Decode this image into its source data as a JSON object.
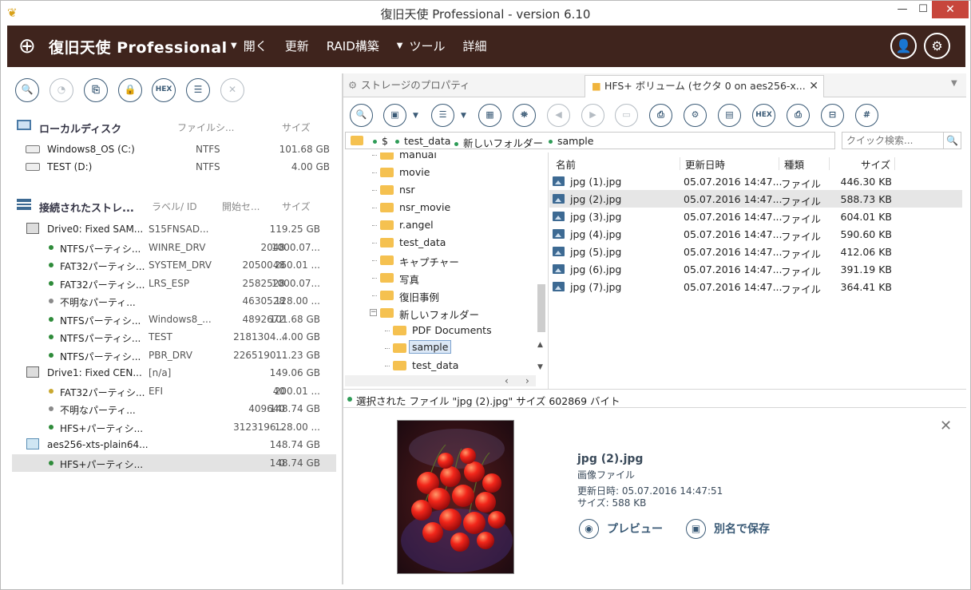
{
  "window": {
    "title": "復旧天使 Professional - version 6.10"
  },
  "header": {
    "brand": "復旧天使 Professional",
    "menu": [
      {
        "label": "開く",
        "caret": true
      },
      {
        "label": "更新",
        "caret": false
      },
      {
        "label": "RAID構築",
        "caret": false
      },
      {
        "label": "ツール",
        "caret": true
      },
      {
        "label": "詳細",
        "caret": false
      }
    ]
  },
  "left": {
    "toolbar_hex": "HEX",
    "local": {
      "title": "ローカルディスク",
      "col_fs": "ファイルシ...",
      "col_size": "サイズ",
      "rows": [
        {
          "name": "Windows8_OS (C:)",
          "fs": "NTFS",
          "size": "101.68 GB"
        },
        {
          "name": "TEST (D:)",
          "fs": "NTFS",
          "size": "4.00 GB"
        }
      ]
    },
    "connected": {
      "title": "接続されたストレ...",
      "col_label": "ラベル/ ID",
      "col_start": "開始セ...",
      "col_size": "サイズ",
      "rows": [
        {
          "type": "drive",
          "name": "Drive0: Fixed SAM...",
          "label": "S15FNSAD...",
          "start": "",
          "size": "119.25 GB"
        },
        {
          "type": "part",
          "color": "#2e8b3a",
          "name": "NTFSパーティシ...",
          "label": "WINRE_DRV",
          "start": "2048",
          "size": "1000.07..."
        },
        {
          "type": "part",
          "color": "#2e8b3a",
          "name": "FAT32パーティシ...",
          "label": "SYSTEM_DRV",
          "start": "2050048",
          "size": "260.01 ..."
        },
        {
          "type": "part",
          "color": "#2e8b3a",
          "name": "FAT32パーティシ...",
          "label": "LRS_ESP",
          "start": "2582528",
          "size": "1000.07..."
        },
        {
          "type": "part",
          "color": "#8a8a8a",
          "name": "不明なパーティ...",
          "label": "",
          "start": "4630528",
          "size": "128.00 ..."
        },
        {
          "type": "part",
          "color": "#2e8b3a",
          "name": "NTFSパーティシ...",
          "label": "Windows8_...",
          "start": "4892672",
          "size": "101.68 GB"
        },
        {
          "type": "part",
          "color": "#2e8b3a",
          "name": "NTFSパーティシ...",
          "label": "TEST",
          "start": "2181304...",
          "size": "4.00 GB"
        },
        {
          "type": "part",
          "color": "#2e8b3a",
          "name": "NTFSパーティシ...",
          "label": "PBR_DRV",
          "start": "2265190...",
          "size": "11.23 GB"
        },
        {
          "type": "drive",
          "name": "Drive1: Fixed CEN...",
          "label": "[n/a]",
          "start": "",
          "size": "149.06 GB"
        },
        {
          "type": "part",
          "color": "#c9a830",
          "name": "FAT32パーティシ...",
          "label": "EFI",
          "start": "40",
          "size": "200.01 ..."
        },
        {
          "type": "part",
          "color": "#8a8a8a",
          "name": "不明なパーティ...",
          "label": "",
          "start": "409640",
          "size": "148.74 GB"
        },
        {
          "type": "part",
          "color": "#2e8b3a",
          "name": "HFS+パーティシ...",
          "label": "",
          "start": "3123196...",
          "size": "128.00 ..."
        },
        {
          "type": "volume",
          "name": "aes256-xts-plain64...",
          "label": "",
          "start": "",
          "size": "148.74 GB"
        },
        {
          "type": "part",
          "color": "#2e8b3a",
          "name": "HFS+パーティシ...",
          "label": "",
          "start": "0",
          "size": "148.74 GB",
          "selected": true
        }
      ]
    }
  },
  "tabs": [
    {
      "label": "ストレージのプロパティ"
    },
    {
      "label": "HFS+ ボリューム (セクタ 0 on aes256-x..."
    }
  ],
  "right_toolbar_hex": "HEX",
  "breadcrumb": [
    "$",
    "test_data",
    "新しいフォルダー",
    "sample"
  ],
  "search": {
    "placeholder": "クイック検索..."
  },
  "tree": [
    {
      "label": "manual",
      "level": 0
    },
    {
      "label": "movie",
      "level": 0
    },
    {
      "label": "nsr",
      "level": 0
    },
    {
      "label": "nsr_movie",
      "level": 0
    },
    {
      "label": "r.angel",
      "level": 0
    },
    {
      "label": "test_data",
      "level": 0
    },
    {
      "label": "キャプチャー",
      "level": 0
    },
    {
      "label": "写真",
      "level": 0
    },
    {
      "label": "復旧事例",
      "level": 0
    },
    {
      "label": "新しいフォルダー",
      "level": 0,
      "expanded": true
    },
    {
      "label": "PDF Documents",
      "level": 1
    },
    {
      "label": "sample",
      "level": 1,
      "selected": true
    },
    {
      "label": "test_data",
      "level": 1
    }
  ],
  "files": {
    "columns": {
      "name": "名前",
      "date": "更新日時",
      "type": "種類",
      "size": "サイズ"
    },
    "rows": [
      {
        "name": "jpg (1).jpg",
        "date": "05.07.2016 14:47...",
        "type": "ファイル",
        "size": "446.30 KB"
      },
      {
        "name": "jpg (2).jpg",
        "date": "05.07.2016 14:47...",
        "type": "ファイル",
        "size": "588.73 KB",
        "selected": true
      },
      {
        "name": "jpg (3).jpg",
        "date": "05.07.2016 14:47...",
        "type": "ファイル",
        "size": "604.01 KB"
      },
      {
        "name": "jpg (4).jpg",
        "date": "05.07.2016 14:47...",
        "type": "ファイル",
        "size": "590.60 KB"
      },
      {
        "name": "jpg (5).jpg",
        "date": "05.07.2016 14:47...",
        "type": "ファイル",
        "size": "412.06 KB"
      },
      {
        "name": "jpg (6).jpg",
        "date": "05.07.2016 14:47...",
        "type": "ファイル",
        "size": "391.19 KB"
      },
      {
        "name": "jpg (7).jpg",
        "date": "05.07.2016 14:47...",
        "type": "ファイル",
        "size": "364.41 KB"
      }
    ]
  },
  "status": {
    "text": "選択された ファイル \"jpg (2).jpg\"  サイズ 602869 バイト"
  },
  "preview": {
    "file_name": "jpg (2).jpg",
    "file_type": "画像ファイル",
    "modified": "更新日時: 05.07.2016 14:47:51",
    "size": "サイズ: 588 KB",
    "preview_label": "プレビュー",
    "save_as_label": "別名で保存"
  }
}
